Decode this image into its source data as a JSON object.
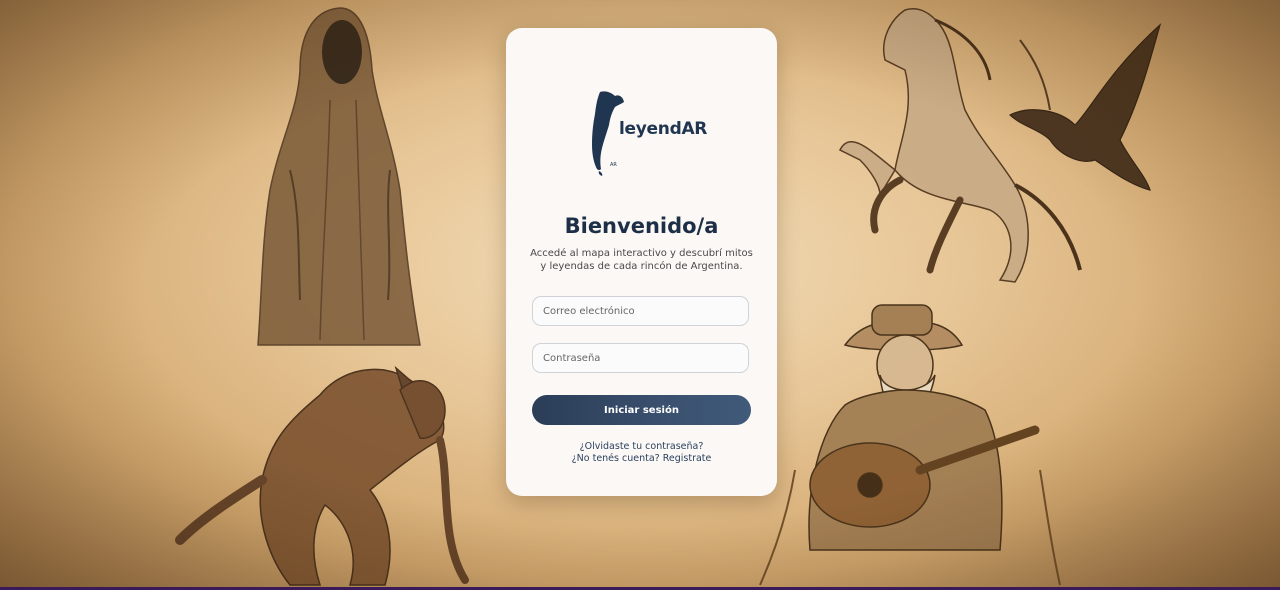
{
  "brand": {
    "name": "leyendAR"
  },
  "login": {
    "title": "Bienvenido/a",
    "subtitle": "Accedé al mapa interactivo y descubrí mitos y leyendas de cada rincón de Argentina.",
    "email_placeholder": "Correo electrónico",
    "email_value": "",
    "password_placeholder": "Contraseña",
    "password_value": "",
    "submit_label": "Iniciar sesión",
    "forgot_link": "¿Olvidaste tu contraseña?",
    "register_link": "¿No tenés cuenta? Registrate"
  },
  "colors": {
    "accent": "#2b3d57",
    "brand_text": "#1f3550",
    "card_bg": "#fbf8f5",
    "background": "#e7c697"
  },
  "background_illustrations": [
    "hooded-phantom-icon",
    "werewolf-icon",
    "rearing-horse-icon",
    "crow-icon",
    "gaucho-guitar-player-icon"
  ]
}
